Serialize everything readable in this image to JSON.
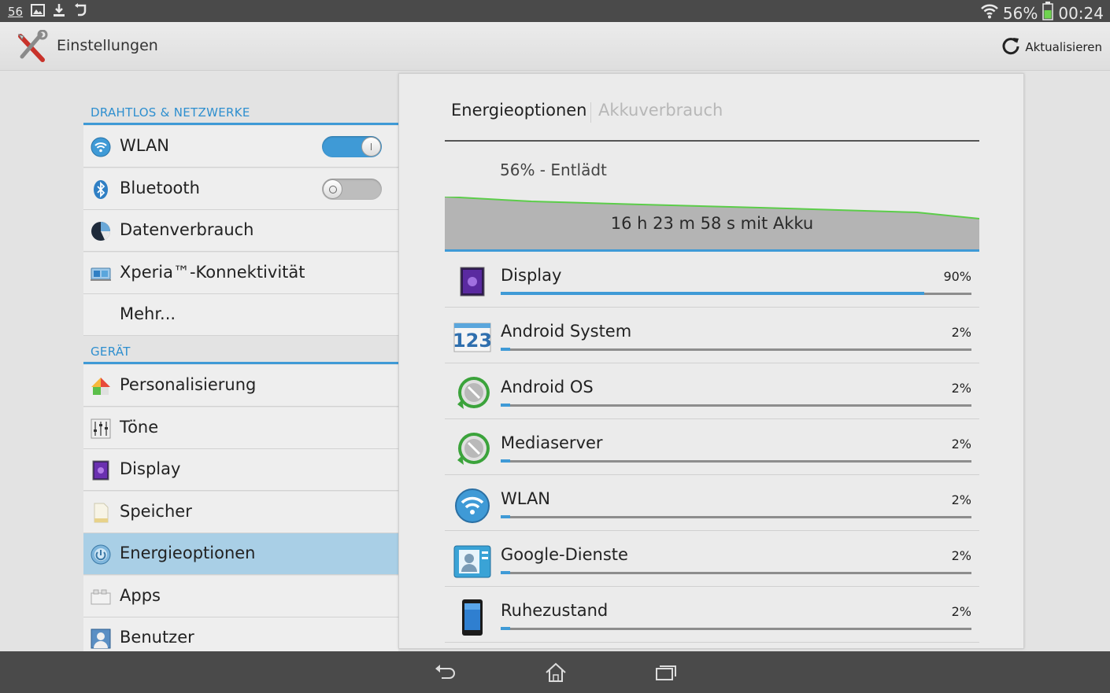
{
  "statusbar": {
    "notification_count": "56",
    "battery": "56%",
    "time": "00:24",
    "icons": [
      "gallery-icon",
      "download-icon",
      "sync-icon",
      "wifi-icon",
      "battery-icon"
    ]
  },
  "actionbar": {
    "title": "Einstellungen",
    "refresh_label": "Aktualisieren",
    "icons": [
      "settings-tools-icon",
      "refresh-icon"
    ]
  },
  "sidebar": {
    "sections": [
      {
        "header": "DRAHTLOS & NETZWERKE",
        "items": [
          {
            "label": "WLAN",
            "icon": "wifi-icon",
            "toggle": true
          },
          {
            "label": "Bluetooth",
            "icon": "bluetooth-icon",
            "toggle": false
          },
          {
            "label": "Datenverbrauch",
            "icon": "data-usage-icon"
          },
          {
            "label": "Xperia™-Konnektivität",
            "icon": "connectivity-icon"
          },
          {
            "label": "Mehr..."
          }
        ]
      },
      {
        "header": "GERÄT",
        "items": [
          {
            "label": "Personalisierung",
            "icon": "personalization-icon"
          },
          {
            "label": "Töne",
            "icon": "sound-icon"
          },
          {
            "label": "Display",
            "icon": "display-icon"
          },
          {
            "label": "Speicher",
            "icon": "storage-icon"
          },
          {
            "label": "Energieoptionen",
            "icon": "power-icon",
            "selected": true
          },
          {
            "label": "Apps",
            "icon": "apps-icon"
          },
          {
            "label": "Benutzer",
            "icon": "user-icon"
          }
        ]
      }
    ]
  },
  "panel": {
    "tab_active": "Energieoptionen",
    "tab_inactive": "Akkuverbrauch",
    "battery_status": "56% - Entlädt",
    "battery_time": "16 h 23 m 58 s mit Akku",
    "usage": [
      {
        "name": "Display",
        "percent": "90%",
        "fraction": 0.9,
        "icon": "display-icon"
      },
      {
        "name": "Android System",
        "percent": "2%",
        "fraction": 0.02,
        "icon": "android-system-icon"
      },
      {
        "name": "Android OS",
        "percent": "2%",
        "fraction": 0.02,
        "icon": "android-os-icon"
      },
      {
        "name": "Mediaserver",
        "percent": "2%",
        "fraction": 0.02,
        "icon": "mediaserver-icon"
      },
      {
        "name": "WLAN",
        "percent": "2%",
        "fraction": 0.02,
        "icon": "wifi-icon"
      },
      {
        "name": "Google-Dienste",
        "percent": "2%",
        "fraction": 0.02,
        "icon": "google-services-icon"
      },
      {
        "name": "Ruhezustand",
        "percent": "2%",
        "fraction": 0.02,
        "icon": "phone-idle-icon"
      }
    ]
  },
  "navbar": {
    "icons": [
      "back-icon",
      "home-icon",
      "recent-apps-icon"
    ]
  },
  "colors": {
    "accent": "#3f9ad6",
    "selected_row": "#a9cfe6",
    "graph_line": "#5ccd4a",
    "bars": "#4a4a4a"
  }
}
